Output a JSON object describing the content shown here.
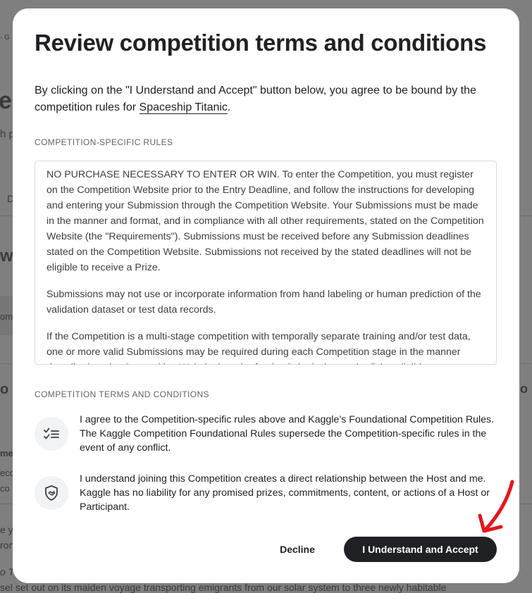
{
  "background": {
    "fragments": [
      "· G",
      "es",
      "h p",
      "D",
      "w",
      "om",
      "o",
      "me",
      "eco",
      "co",
      "e y",
      "ron",
      "o T",
      "sel set out on its maiden voyage transporting emigrants from our solar system to three newly habitable",
      "o"
    ]
  },
  "modal": {
    "title": "Review competition terms and conditions",
    "intro_prefix": "By clicking on the \"I Understand and Accept\" button below, you agree to be bound by the competition rules for ",
    "intro_link": "Spaceship Titanic",
    "intro_suffix": ".",
    "rules_label": "COMPETITION-SPECIFIC RULES",
    "rules_paragraphs": [
      "NO PURCHASE NECESSARY TO ENTER OR WIN. To enter the Competition, you must register on the Competition Website prior to the Entry Deadline, and follow the instructions for developing and entering your Submission through the Competition Website. Your Submissions must be made in the manner and format, and in compliance with all other requirements, stated on the Competition Website (the \"Requirements\"). Submissions must be received before any Submission deadlines stated on the Competition Website. Submissions not received by the stated deadlines will not be eligible to receive a Prize.",
      "Submissions may not use or incorporate information from hand labeling or human prediction of the validation dataset or test data records.",
      "If the Competition is a multi-stage competition with temporally separate training and/or test data, one or more valid Submissions may be required during each Competition stage in the manner described on the Competition Website in order for the Submissions to be Prize eligible."
    ],
    "terms_label": "COMPETITION TERMS AND CONDITIONS",
    "terms": [
      {
        "icon": "checklist-icon",
        "text": "I agree to the Competition-specific rules above and Kaggle’s Foundational Competition Rules. The Kaggle Competition Foundational Rules supersede the Competition-specific rules in the event of any conflict."
      },
      {
        "icon": "shield-handshake-icon",
        "text": "I understand joining this Competition creates a direct relationship between the Host and me. Kaggle has no liability for any promised prizes, commitments, content, or actions of a Host or Participant."
      }
    ],
    "decline_label": "Decline",
    "accept_label": "I Understand and Accept"
  },
  "colors": {
    "accept_button": "#202124",
    "annotation_arrow": "#e8141b"
  }
}
